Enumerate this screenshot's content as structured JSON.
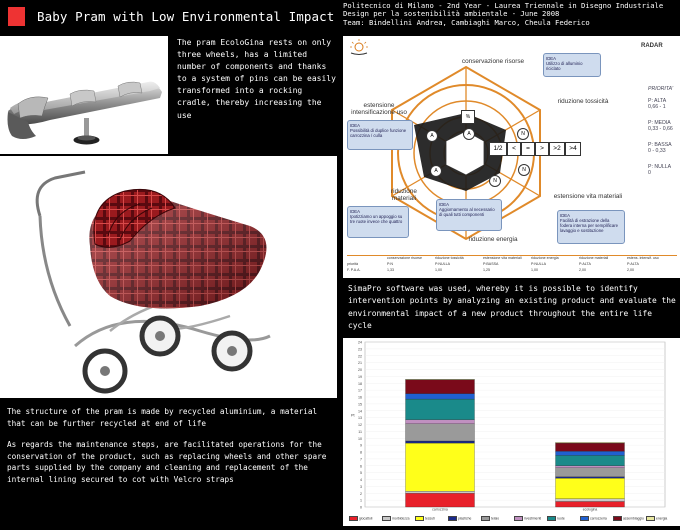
{
  "header": {
    "title": "Baby Pram with Low Environmental Impact",
    "accent_color": "#e33333",
    "info_line1": "Politecnico di Milano - 2nd Year - Laurea Triennale in Disegno Industriale",
    "info_line2": "Design per la sostenibilità ambientale - June 2008",
    "info_line3": "Team: Bindellini Andrea, Cambiaghi Marco, Cheula Federico"
  },
  "top_description": "The pram EcoloGina rests on only three wheels, has a limited number of components and thanks to a system of pins can be easily transformed into a rocking cradle, thereby increasing the use",
  "left_text": {
    "para1": "The structure of the pram is made by recycled aluminium, a material that can be further recycled at end of life",
    "para2": "As regards the maintenance steps, are facilitated operations for the conservation of the product, such as replacing wheels and other spare parts supplied by the company and cleaning and replacement of the internal lining secured to cot with Velcro straps"
  },
  "radar": {
    "heading": "RADAR",
    "axes": {
      "top": "conservazione risorse",
      "top_left": "estensione intensificazione uso",
      "top_right": "riduzione tossicità",
      "bottom_left": "riduzione materiali",
      "bottom": "riduzione energia",
      "bottom_right": "estensione vita materiali"
    },
    "scale": [
      "1/2",
      "<",
      "=",
      ">",
      ">2",
      ">4"
    ],
    "markers": [
      "A",
      "N",
      "A",
      "N",
      "N",
      "A"
    ],
    "ideas": [
      {
        "title": "IDEA",
        "text": "Utilizzo di alluminio riciclato"
      },
      {
        "title": "IDEA",
        "text": "Possibilità di duplice funzione carrozzina / culla"
      },
      {
        "title": "IDEA",
        "text": "Ipotizziamo un appoggio su tre ruote invece che quattro"
      },
      {
        "title": "IDEA",
        "text": "Aggiornamento al necessario di quali tutti componenti"
      },
      {
        "title": "IDEA",
        "text": "Facilità di estrazione della fodera interna per semplificare lavaggio e sostituzione"
      }
    ],
    "priority": {
      "title": "PRIORITA'",
      "levels": [
        {
          "label": "P: ALTA",
          "range": "0,66 - 1"
        },
        {
          "label": "P: MEDIA",
          "range": "0,33 - 0,66"
        },
        {
          "label": "P: BASSA",
          "range": "0 - 0,33"
        },
        {
          "label": "P: NULLA",
          "range": "0"
        }
      ]
    },
    "table": {
      "headers": [
        "",
        "conservazione risorse",
        "riduzione tossicità",
        "estensione vita materiali",
        "riduzione energia",
        "riduzione materiali",
        "estens. intensif. uso"
      ],
      "rows": [
        [
          "priorità",
          "P:N",
          "P:NULLA",
          "P:BASSA",
          "P:NULLA",
          "P:ALTA",
          "P:ALTA"
        ],
        [
          "F. P.A.A.",
          "1,33",
          "1,00",
          "1,25",
          "1,00",
          "2,00",
          "2,00"
        ]
      ]
    }
  },
  "sima_text": "SimaPro software was used, whereby it is possible to identify intervention points by analyzing an existing product and evaluate the environmental impact of a new product throughout the entire life cycle",
  "chart_data": {
    "type": "bar",
    "stacked": true,
    "categories": [
      "carrozzina",
      "ecologina"
    ],
    "ylim": [
      0,
      24
    ],
    "yticks": [
      0,
      1,
      2,
      3,
      4,
      5,
      6,
      7,
      8,
      9,
      10,
      11,
      12,
      13,
      14,
      15,
      16,
      17,
      18,
      19,
      20,
      21,
      22,
      23,
      24
    ],
    "ylabel": "Pt",
    "series": [
      {
        "name": "giocattoli",
        "color": "#e8202a",
        "values": [
          2.0,
          0.8
        ]
      },
      {
        "name": "morbidezza",
        "color": "#c8c8c8",
        "values": [
          0.3,
          0.4
        ]
      },
      {
        "name": "tessuti",
        "color": "#ffff1a",
        "values": [
          7.0,
          3.0
        ]
      },
      {
        "name": "plastiche",
        "color": "#1a2a8a",
        "values": [
          0.3,
          0.2
        ]
      },
      {
        "name": "telaio",
        "color": "#9a9a9a",
        "values": [
          2.5,
          1.3
        ]
      },
      {
        "name": "rivestimenti",
        "color": "#c090c0",
        "values": [
          0.6,
          0.3
        ]
      },
      {
        "name": "ruote",
        "color": "#1a8a8a",
        "values": [
          3.0,
          1.5
        ]
      },
      {
        "name": "carrozzeria",
        "color": "#2060d0",
        "values": [
          0.8,
          0.6
        ]
      },
      {
        "name": "assemblaggio",
        "color": "#7a0a1a",
        "values": [
          2.0,
          1.2
        ]
      },
      {
        "name": "energia",
        "color": "#e8e8a0",
        "values": [
          0.1,
          0.1
        ]
      }
    ]
  }
}
